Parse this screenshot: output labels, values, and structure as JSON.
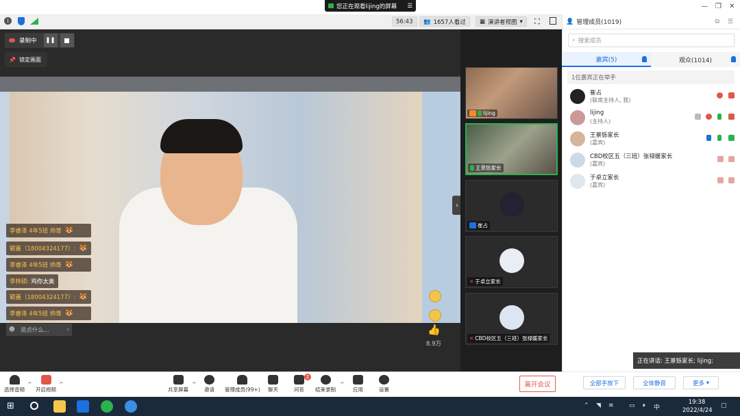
{
  "window": {
    "share_banner": "您正在观看lijing的屏幕"
  },
  "toolbar": {
    "timer": "56:43",
    "viewers": "1657人看过",
    "view_mode": "演讲者视图"
  },
  "recording": {
    "label": "录制中"
  },
  "lock": {
    "label": "锁定画面"
  },
  "chat": [
    {
      "who": "李睿泽 4年5班 帅哥",
      "msg": ""
    },
    {
      "who": "颖蓋（18004324177）:",
      "msg": ""
    },
    {
      "who": "李睿泽 4年5班 帅哥",
      "msg": ""
    },
    {
      "who": "李梓硕:",
      "msg": "鸡你太美"
    },
    {
      "who": "颖蓋（18004324177）:",
      "msg": ""
    },
    {
      "who": "李睿泽 4年5班 帅哥",
      "msg": ""
    }
  ],
  "chat_input": {
    "placeholder": "说点什么..."
  },
  "likes": "8.9万",
  "tiles": [
    {
      "name": "lijing"
    },
    {
      "name": "王景铄家长"
    },
    {
      "name": "崔占"
    },
    {
      "name": "于卓立家长"
    },
    {
      "name": "CBD校区五（三班）张禄媛家长"
    }
  ],
  "panel": {
    "title": "管理成员(1019)",
    "search_placeholder": "搜索成员",
    "tab_guests": "嘉宾(5)",
    "tab_audience": "观众(1014)",
    "raise_notice": "1位嘉宾正在举手",
    "members": [
      {
        "name": "崔占",
        "role": "(联席主持人, 我)"
      },
      {
        "name": "lijing",
        "role": "(主持人)"
      },
      {
        "name": "王景铄家长",
        "role": "(嘉宾)"
      },
      {
        "name": "CBD校区五（三班）张禄媛家长",
        "role": "(嘉宾)"
      },
      {
        "name": "于卓立家长",
        "role": "(嘉宾)"
      }
    ],
    "lower_hands": "全部手放下",
    "mute_all": "全体静音",
    "more": "更多"
  },
  "speaking": "正在讲话: 王景铄家长; lijing;",
  "bottom": {
    "audio": "选择音频",
    "video": "开启视频",
    "share": "共享屏幕",
    "invite": "邀请",
    "manage": "管理成员(99+)",
    "chat": "聊天",
    "qa": "问答",
    "qa_badge": "2",
    "end_record": "结束录制",
    "apps": "应用",
    "settings": "设置",
    "leave": "离开会议"
  },
  "clock": {
    "time": "19:38",
    "date": "2022/4/24"
  },
  "tray": {
    "ime": "中"
  },
  "colors": {
    "accent": "#1e6fe0",
    "end": "#e0574a",
    "green": "#2bb24c"
  }
}
